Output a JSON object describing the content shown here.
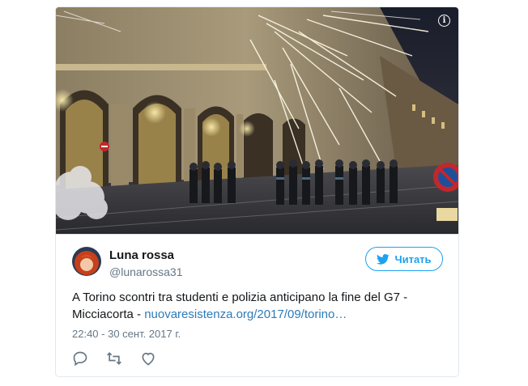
{
  "tweet": {
    "author_name": "Luna rossa",
    "author_handle": "@lunarossa31",
    "follow_label": "Читать",
    "text": "A Torino scontri tra studenti e polizia anticipano la fine del G7 - Micciacorta - ",
    "link": "nuovaresistenza.org/2017/09/torino…",
    "timestamp": "22:40 - 30 сент. 2017 г."
  },
  "icons": {
    "info": "info-icon",
    "twitter": "twitter-bird-icon",
    "reply": "reply-icon",
    "retweet": "retweet-icon",
    "like": "heart-icon"
  },
  "colors": {
    "accent": "#1da1f2",
    "link": "#2b7bb9",
    "muted": "#657786",
    "border": "#e1e8ed"
  }
}
